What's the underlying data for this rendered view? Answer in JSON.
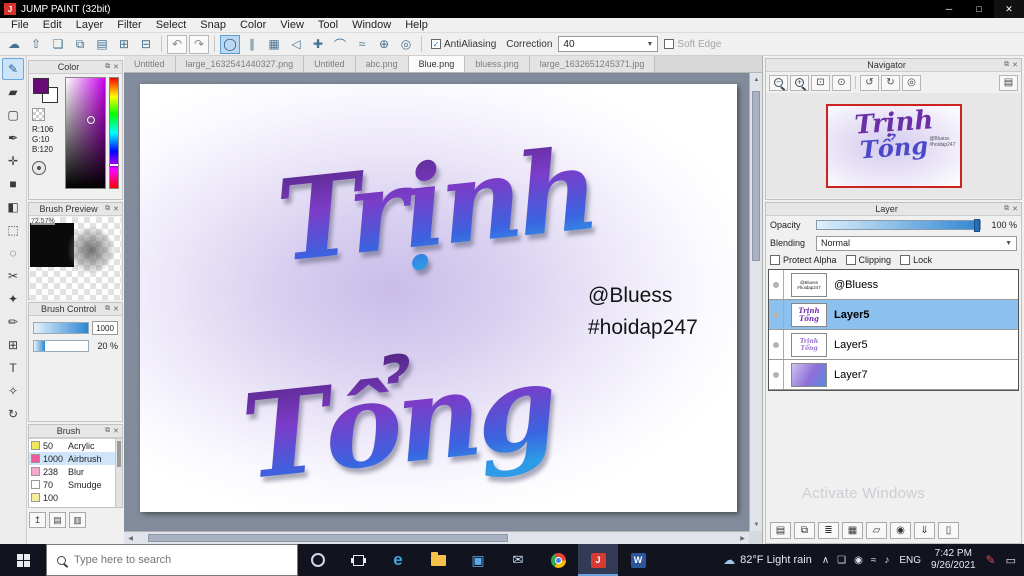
{
  "colors": {
    "accent_blue": "#2f86d2",
    "selected_layer": "#8cc0ee",
    "navigator_border": "#cc2222",
    "text_gradient_top": "#4e2277",
    "text_gradient_mid": "#7c3cc8",
    "text_gradient_low": "#3b63e0",
    "text_gradient_bottom": "#2d9be6",
    "foreground_color": "#6a0a78"
  },
  "panel_icons": {
    "popout": "⧉",
    "close": "✕"
  },
  "icons": {
    "arrow_up": "▲",
    "arrow_down": "▼",
    "arrow_left": "◀",
    "arrow_right": "▶",
    "dropdown": "▼"
  },
  "titlebar": {
    "title": "JUMP PAINT (32bit)",
    "logo_letter": "J",
    "minimize": "─",
    "maximize": "□",
    "close": "✕"
  },
  "menu": {
    "items": [
      "File",
      "Edit",
      "Layer",
      "Filter",
      "Select",
      "Snap",
      "Color",
      "View",
      "Tool",
      "Window",
      "Help"
    ]
  },
  "toolbar": {
    "file_icons": [
      {
        "name": "cloud-icon",
        "glyph": "☁"
      },
      {
        "name": "publish-icon",
        "glyph": "⇧"
      },
      {
        "name": "comment-icon",
        "glyph": "❏"
      },
      {
        "name": "screen-icon",
        "glyph": "⧉"
      },
      {
        "name": "page-icon",
        "glyph": "▤"
      },
      {
        "name": "panel-grid-icon",
        "glyph": "⊞"
      },
      {
        "name": "comic-frame-icon",
        "glyph": "⊟"
      }
    ],
    "undo_glyph": "↶",
    "redo_glyph": "↷",
    "snap_icons": [
      {
        "name": "snap-off-icon",
        "glyph": "◯",
        "selected": true
      },
      {
        "name": "snap-parallel-icon",
        "glyph": "∥"
      },
      {
        "name": "snap-grid-icon",
        "glyph": "▦"
      },
      {
        "name": "snap-vanish-icon",
        "glyph": "◁"
      },
      {
        "name": "snap-cross-icon",
        "glyph": "✚"
      },
      {
        "name": "snap-arc-icon",
        "glyph": "⌒"
      },
      {
        "name": "snap-curve-icon",
        "glyph": "≈"
      },
      {
        "name": "snap-radial-icon",
        "glyph": "⊕"
      },
      {
        "name": "snap-circle-icon",
        "glyph": "◎"
      }
    ],
    "antialiasing_label": "AntiAliasing",
    "correction_label": "Correction",
    "correction_value": "40",
    "softedge_label": "Soft Edge"
  },
  "tabs": [
    {
      "label": "Untitled",
      "active": false
    },
    {
      "label": "large_1632541440327.png",
      "active": false
    },
    {
      "label": "Untitled",
      "active": false
    },
    {
      "label": "abc.png",
      "active": false
    },
    {
      "label": "Blue.png",
      "active": true
    },
    {
      "label": "bluess.png",
      "active": false
    },
    {
      "label": "large_1632651245371.jpg",
      "active": false
    }
  ],
  "tools": [
    {
      "name": "pen-tool",
      "glyph": "✎",
      "selected": true
    },
    {
      "name": "eraser-tool",
      "glyph": "▰",
      "selected": false
    },
    {
      "name": "stamp-tool",
      "glyph": "▢",
      "selected": false
    },
    {
      "name": "dip-pen-tool",
      "glyph": "✒",
      "selected": false
    },
    {
      "name": "move-tool",
      "glyph": "✛",
      "selected": false
    },
    {
      "name": "shape-tool",
      "glyph": "■",
      "selected": false
    },
    {
      "name": "fill-tool",
      "glyph": "◧",
      "selected": false
    },
    {
      "name": "select-rect-tool",
      "glyph": "⬚",
      "selected": false
    },
    {
      "name": "select-ellipse-tool",
      "glyph": "◌",
      "selected": false
    },
    {
      "name": "lasso-tool",
      "glyph": "✂",
      "selected": false
    },
    {
      "name": "magic-wand-tool",
      "glyph": "✦",
      "selected": false
    },
    {
      "name": "correction-pen-tool",
      "glyph": "✏",
      "selected": false
    },
    {
      "name": "transform-tool",
      "glyph": "⊞",
      "selected": false
    },
    {
      "name": "text-tool",
      "glyph": "T",
      "selected": false
    },
    {
      "name": "gradient-tool",
      "glyph": "✧",
      "selected": false
    },
    {
      "name": "rotate-view-tool",
      "glyph": "↻",
      "selected": false
    }
  ],
  "color_panel": {
    "title": "Color",
    "r_label": "R:106",
    "g_label": "G:10",
    "b_label": "B:120"
  },
  "brush_preview": {
    "title": "Brush Preview",
    "zoom_label": "72.57%"
  },
  "brush_control": {
    "title": "Brush Control",
    "size_value": "1000",
    "opacity_value": "20 %"
  },
  "brush_panel": {
    "title": "Brush",
    "items": [
      {
        "size": "50",
        "name": "Acrylic",
        "swatch": "sw-yellow",
        "selected": false
      },
      {
        "size": "1000",
        "name": "Airbrush",
        "swatch": "sw-pink",
        "selected": true
      },
      {
        "size": "238",
        "name": "Blur",
        "swatch": "sw-pink2",
        "selected": false
      },
      {
        "size": "70",
        "name": "Smudge",
        "swatch": "sw-white",
        "selected": false
      },
      {
        "size": "100",
        "name": "",
        "swatch": "sw-yellow2",
        "selected": false
      }
    ]
  },
  "side_buttons": [
    {
      "name": "dock-toggle-icon",
      "glyph": "↥"
    },
    {
      "name": "page-list-icon",
      "glyph": "▤"
    },
    {
      "name": "page-add-icon",
      "glyph": "▥"
    }
  ],
  "canvas": {
    "line1": "Trịnh",
    "line2": "Tổng",
    "credit1": "@Bluess",
    "credit2": "#hoidap247"
  },
  "navigator": {
    "title": "Navigator",
    "zoom_out": "−",
    "zoom_in": "+",
    "fit_glyph": "⊡",
    "actual_glyph": "⊙",
    "rotate_left": "↺",
    "rotate_right": "↻",
    "reset_glyph": "◎",
    "spread_glyph": "▤"
  },
  "layer_panel": {
    "title": "Layer",
    "opacity_label": "Opacity",
    "opacity_value": "100 %",
    "blending_label": "Blending",
    "blending_value": "Normal",
    "checks": [
      {
        "label": "Protect Alpha",
        "checked": true
      },
      {
        "label": "Clipping",
        "checked": false
      },
      {
        "label": "Lock",
        "checked": false
      }
    ],
    "layers": [
      {
        "name": "@Bluess",
        "thumb": "thumb-credit",
        "thumb_text": "@Bluess #hoidap247",
        "selected": false
      },
      {
        "name": "Layer5",
        "thumb": "thumb-script",
        "thumb_text": "Trịnh Tổng",
        "selected": true
      },
      {
        "name": "Layer5",
        "thumb": "thumb-script-light",
        "thumb_text": "Trịnh Tổng",
        "selected": false
      },
      {
        "name": "Layer7",
        "thumb": "thumb-gradient",
        "thumb_text": "",
        "selected": false
      }
    ],
    "bottom_icons": [
      {
        "name": "new-layer-icon",
        "glyph": "▤"
      },
      {
        "name": "duplicate-layer-icon",
        "glyph": "⧉"
      },
      {
        "name": "layer-stack-icon",
        "glyph": "≣"
      },
      {
        "name": "tile-icon",
        "glyph": "▦"
      },
      {
        "name": "folder-icon",
        "glyph": "▱"
      },
      {
        "name": "material-icon",
        "glyph": "◉"
      },
      {
        "name": "merge-down-icon",
        "glyph": "⇓"
      },
      {
        "name": "delete-layer-icon",
        "glyph": "▯"
      }
    ],
    "watermark": "Activate Windows"
  },
  "taskbar": {
    "search_placeholder": "Type here to search",
    "apps": [
      {
        "name": "edge-icon",
        "glyph": "e",
        "style": "app-edge",
        "active": false
      },
      {
        "name": "file-explorer-icon",
        "glyph": "",
        "style": "app-folder",
        "active": false
      },
      {
        "name": "photos-icon",
        "glyph": "▣",
        "style": "app-photos",
        "active": false
      },
      {
        "name": "mail-icon",
        "glyph": "✉",
        "style": "app-mail",
        "active": false
      },
      {
        "name": "chrome-icon",
        "glyph": "",
        "style": "app-chrome",
        "active": false
      },
      {
        "name": "jump-paint-icon",
        "glyph": "J",
        "style": "app-jump",
        "active": true
      },
      {
        "name": "word-icon",
        "glyph": "W",
        "style": "app-word",
        "active": false
      }
    ],
    "weather_glyph": "☁",
    "weather": "82°F Light rain",
    "tray_icons": [
      {
        "name": "hidden-icons-chevron",
        "glyph": "∧"
      },
      {
        "name": "chat-icon",
        "glyph": "❏"
      },
      {
        "name": "eye-icon",
        "glyph": "◉"
      },
      {
        "name": "network-icon",
        "glyph": "≈"
      },
      {
        "name": "volume-icon",
        "glyph": "♪"
      }
    ],
    "lang": "ENG",
    "time": "7:42 PM",
    "date": "9/26/2021",
    "pen_glyph": "✎",
    "notification_glyph": "▭"
  }
}
